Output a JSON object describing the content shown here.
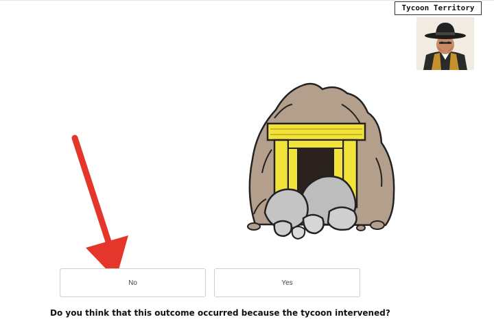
{
  "header": {
    "title": "Tycoon Territory"
  },
  "illustration": {
    "subject": "blocked-mine-entrance"
  },
  "avatar": {
    "subject": "cowboy-tycoon"
  },
  "annotation": {
    "type": "arrow",
    "color": "#e5362b",
    "points_to": "no-button"
  },
  "answers": {
    "no_label": "No",
    "yes_label": "Yes"
  },
  "question": {
    "text": "Do you think that this outcome occurred because the tycoon intervened?"
  },
  "colors": {
    "rock": "#b49e8c",
    "timber": "#f2e23a",
    "boulder": "#bdbdbd",
    "arrow": "#e5362b"
  }
}
